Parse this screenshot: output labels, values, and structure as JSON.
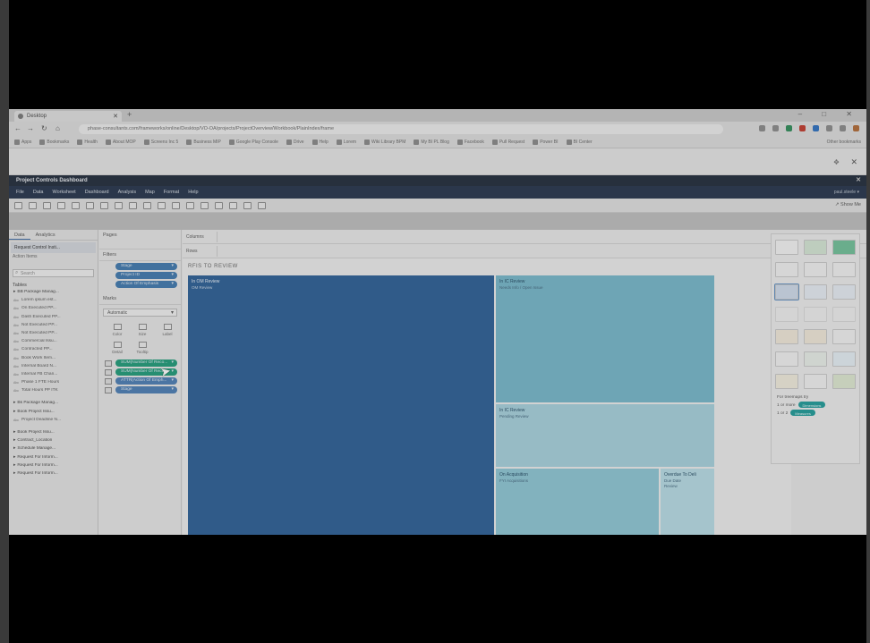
{
  "browser": {
    "tab_title": "Desktop",
    "new_tab": "+",
    "window_controls": "– □ ✕",
    "url": "phase-consultants.com/frameworks/online/Desktop/VO-OA/projects/ProjectOverview/Workbook/PlainIndex/frame",
    "bookmarks": [
      "Apps",
      "Bookmarks",
      "Health",
      "About MOP",
      "Screens Inc 5",
      "Business MIP",
      "Google Play Console",
      "Drive",
      "Help",
      "Lorem",
      "Wiki Library BPM",
      "My BI PL Blog",
      "Facebook",
      "Pull Request",
      "Power BI",
      "BI Center"
    ],
    "other_bookmarks": "Other bookmarks",
    "strip_icon_1": "❖",
    "strip_icon_2": "✕",
    "ext_colors": [
      "#8a8a8a",
      "#8a8a8a",
      "#2e8b57",
      "#c0392b",
      "#2c6fbf",
      "#8a8a8a",
      "#8a8a8a",
      "#b06a35"
    ]
  },
  "tableau": {
    "title": "Project Controls Dashboard",
    "close": "✕",
    "menu": [
      "File",
      "Data",
      "Worksheet",
      "Dashboard",
      "Analysis",
      "Map",
      "Format",
      "Help"
    ],
    "user": "paul.steele ▾",
    "show_me_label": "↗ Show Me",
    "data_pane": {
      "tabs": [
        "Data",
        "Analytics"
      ],
      "source": "Request Control Insti...",
      "source_sub": "Action Items",
      "search_placeholder": "Search",
      "tables_header": "Tables",
      "fields": [
        {
          "kind": "grp",
          "name": "BB Package Manag..."
        },
        {
          "kind": "sub",
          "name": "Lorem ipsum est..."
        },
        {
          "kind": "sub",
          "name": "On Executed PP..."
        },
        {
          "kind": "sub",
          "name": "Dash Executed PP..."
        },
        {
          "kind": "sub",
          "name": "Not Executed PP..."
        },
        {
          "kind": "sub",
          "name": "Not Executed PP..."
        },
        {
          "kind": "sub",
          "name": "Commercial Issu..."
        },
        {
          "kind": "sub",
          "name": "Contracted PP..."
        },
        {
          "kind": "sub",
          "name": "Book Work Item..."
        },
        {
          "kind": "sub",
          "name": "Internal Board N..."
        },
        {
          "kind": "sub",
          "name": "Internal FB Chan..."
        },
        {
          "kind": "sub",
          "name": "Phase 1 FTE Hours"
        },
        {
          "kind": "sub",
          "name": "Total Hours PP ITK"
        },
        {
          "kind": "grp",
          "name": "Bk Package Manag...",
          "gap": true
        },
        {
          "kind": "grp",
          "name": "Book Project Issu..."
        },
        {
          "kind": "sub",
          "name": "Project Deadline N..."
        },
        {
          "kind": "grp",
          "name": "Book Project Issu...",
          "gap": true
        },
        {
          "kind": "grp",
          "name": "Contract_Location"
        },
        {
          "kind": "grp",
          "name": "Schedule Manage..."
        },
        {
          "kind": "grp",
          "name": "Request For Inform..."
        },
        {
          "kind": "grp",
          "name": "Request For Inform..."
        },
        {
          "kind": "grp",
          "name": "Request For Inform..."
        }
      ]
    },
    "cards": {
      "pages": "Pages",
      "filters": "Filters",
      "filter_pills": [
        "Stage",
        "Project ID",
        "Action Of Emphasis"
      ],
      "marks": "Marks",
      "mark_type": "Automatic",
      "mark_buttons": [
        "Color",
        "Size",
        "Label",
        "Detail",
        "Tooltip"
      ],
      "mark_pills": [
        {
          "label": "SUM(Number Of Reco...",
          "color": "green"
        },
        {
          "label": "SUM(Number Of Reco...",
          "color": "green"
        },
        {
          "label": "ATTR(Action Of Emph...",
          "color": "blue2"
        },
        {
          "label": "Stage",
          "color": "blue2"
        }
      ]
    },
    "shelves": {
      "columns": "Columns",
      "rows": "Rows"
    },
    "viz": {
      "title": "RFIS TO REVIEW",
      "cells": [
        {
          "l1": "In OM Review",
          "l2": "OM Review",
          "color": "#2a5e95"
        },
        {
          "l1": "In IC Review",
          "l2": "Needs Info / Open Issue",
          "color": "#74b6c9"
        },
        {
          "l1": "In IC Review",
          "l2": "Pending Review",
          "color": "#a5d0dc"
        },
        {
          "l1": "On Acquisition",
          "l2": "FYI Acquisitions",
          "color": "#8cc5d4"
        },
        {
          "l1": "Overdue To Deli",
          "l2": "Due Date",
          "l3": "Review",
          "color": "#b6dbe4"
        }
      ]
    },
    "show_me": {
      "tiles": [
        {
          "color": "#f3f3f3",
          "kind": "text-table",
          "hl": false
        },
        {
          "color": "#d4e6d4",
          "kind": "symbol-map",
          "hl": false
        },
        {
          "color": "#6fbf98",
          "kind": "filled-map",
          "hl": false
        },
        {
          "color": "#f0f0f0",
          "kind": "heat-map",
          "hl": false
        },
        {
          "color": "#f0f0f0",
          "kind": "highlight-table",
          "hl": false
        },
        {
          "color": "#f0f0f0",
          "kind": "pie-chart",
          "hl": false
        },
        {
          "color": "#cfdbea",
          "kind": "treemap",
          "hl": true
        },
        {
          "color": "#e6ecf3",
          "kind": "horizontal-bars",
          "hl": false
        },
        {
          "color": "#e6ecf3",
          "kind": "stacked-bars",
          "hl": false
        },
        {
          "color": "#f0f0f0",
          "kind": "side-by-side-bars",
          "hl": false
        },
        {
          "color": "#f0f0f0",
          "kind": "circle-view",
          "hl": false
        },
        {
          "color": "#f0f0f0",
          "kind": "side-by-side-circles",
          "hl": false
        },
        {
          "color": "#f0e8d8",
          "kind": "lines-continuous",
          "hl": false
        },
        {
          "color": "#f0e8d8",
          "kind": "lines-discrete",
          "hl": false
        },
        {
          "color": "#f0f0f0",
          "kind": "dual-lines",
          "hl": false
        },
        {
          "color": "#f0f0f0",
          "kind": "area-continuous",
          "hl": false
        },
        {
          "color": "#e8eee8",
          "kind": "area-discrete",
          "hl": false
        },
        {
          "color": "#e4eef4",
          "kind": "dual-combination",
          "hl": false
        },
        {
          "color": "#f0ecdc",
          "kind": "scatter-plot",
          "hl": false
        },
        {
          "color": "#f0f0f0",
          "kind": "histogram",
          "hl": false
        },
        {
          "color": "#dde8d0",
          "kind": "bullet-graph",
          "hl": false
        }
      ],
      "hint_title": "For treemaps try",
      "hint_line1_prefix": "1 or more",
      "hint_line1_pill": "Dimensions",
      "hint_line2_prefix": "1 or 2",
      "hint_line2_pill": "Measures"
    }
  }
}
